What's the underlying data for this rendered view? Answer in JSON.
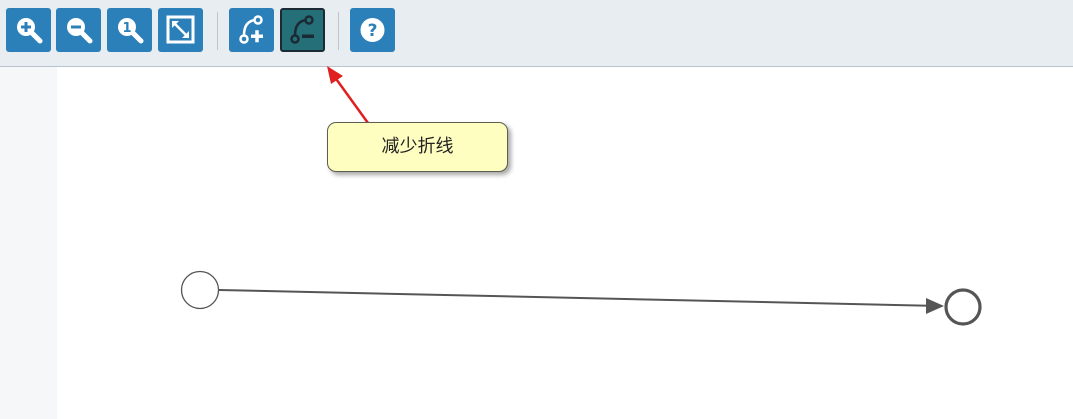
{
  "toolbar": {
    "buttons": [
      {
        "id": "zoom-in",
        "icon": "zoom-in-icon"
      },
      {
        "id": "zoom-out",
        "icon": "zoom-out-icon"
      },
      {
        "id": "zoom-actual",
        "icon": "zoom-actual-size-icon",
        "glyph": "1"
      },
      {
        "id": "fit",
        "icon": "fit-to-window-icon"
      },
      {
        "id": "add-bend",
        "icon": "polyline-add-icon"
      },
      {
        "id": "remove-bend",
        "icon": "polyline-remove-icon",
        "active": true
      },
      {
        "id": "help",
        "icon": "help-icon",
        "glyph": "?"
      }
    ]
  },
  "tooltip": {
    "text": "减少折线"
  },
  "colors": {
    "button": "#2c80b9",
    "button_active": "#246f78",
    "toolbar_bg": "#e8edf2",
    "tooltip_bg": "#fefec0",
    "arrow_annotation": "#e02020",
    "edge": "#555555"
  }
}
